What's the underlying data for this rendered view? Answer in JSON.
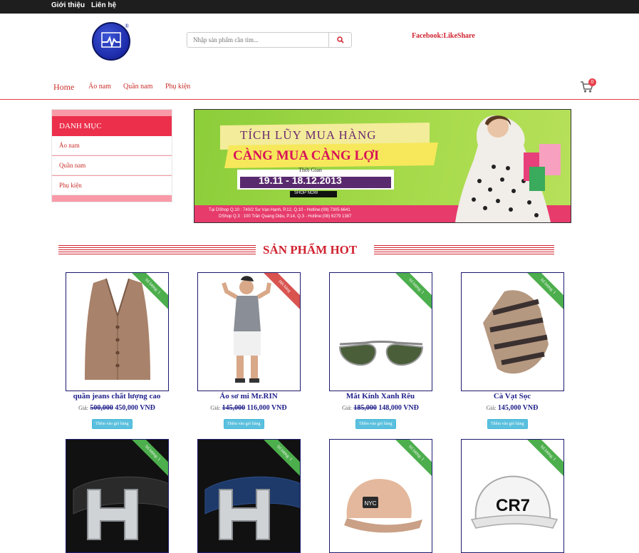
{
  "topbar": {
    "links": [
      "Giới thiệu",
      "Liên hệ"
    ]
  },
  "header": {
    "search_placeholder": "Nhập sản phẩm cần tìm...",
    "facebook": "Facebook:LikeShare",
    "cart_count": "0"
  },
  "nav": [
    "Home",
    "Áo nam",
    "Quần nam",
    "Phụ kiện"
  ],
  "sidebar": {
    "title": "DANH MỤC",
    "items": [
      "Áo nam",
      "Quần nam",
      "Phụ kiện"
    ]
  },
  "banner": {
    "headline1": "TÍCH LŨY MUA HÀNG",
    "headline2": "CÀNG MUA CÀNG LỢI",
    "period_label": "Thời Gian",
    "period": "19.11 - 18.12.2013",
    "cta": "SHOP NOW",
    "addr1": "Tại DShop Q.10 : 740/2 Sư Vạn Hạnh, P.12, Q.10 - Hotline:(08) 7305 6641",
    "addr2": "DShop Q.3 : 100 Trần Quang Diệu, P.14, Q.3 - Hotline:(08) 6279 1387"
  },
  "section_title": "SẢN PHẨM HOT",
  "price_label": "Giá:",
  "add_label": "Thêm vào giỏ hàng",
  "products": [
    {
      "name": "quần jeans chất lượng cao",
      "old_price": "500,000",
      "price": "450,000 VNĐ",
      "ribbon": "Số lượng: 1",
      "ribbon_color": "#4cae4c"
    },
    {
      "name": "Áo sơ mi Mr.RIN",
      "old_price": "145,000",
      "price": "116,000 VNĐ",
      "ribbon": "Hết hàng",
      "ribbon_color": "#d9534f"
    },
    {
      "name": "Mắt Kính Xanh Rêu",
      "old_price": "185,000",
      "price": "148,000 VNĐ",
      "ribbon": "Số lượng: 1",
      "ribbon_color": "#4cae4c"
    },
    {
      "name": "Cà Vạt Sọc",
      "old_price": "",
      "price": "145,000 VNĐ",
      "ribbon": "Số lượng: 1",
      "ribbon_color": "#4cae4c"
    },
    {
      "name": "",
      "old_price": "",
      "price": "",
      "ribbon": "Số lượng: 1",
      "ribbon_color": "#4cae4c"
    },
    {
      "name": "",
      "old_price": "",
      "price": "",
      "ribbon": "Số lượng: 1",
      "ribbon_color": "#4cae4c"
    },
    {
      "name": "",
      "old_price": "",
      "price": "",
      "ribbon": "Số lượng: 1",
      "ribbon_color": "#4cae4c"
    },
    {
      "name": "",
      "old_price": "",
      "price": "",
      "ribbon": "Số lượng: 1",
      "ribbon_color": "#4cae4c"
    }
  ],
  "row2_labels": {
    "cap_text": "NYC",
    "hat_text": "CR7"
  }
}
